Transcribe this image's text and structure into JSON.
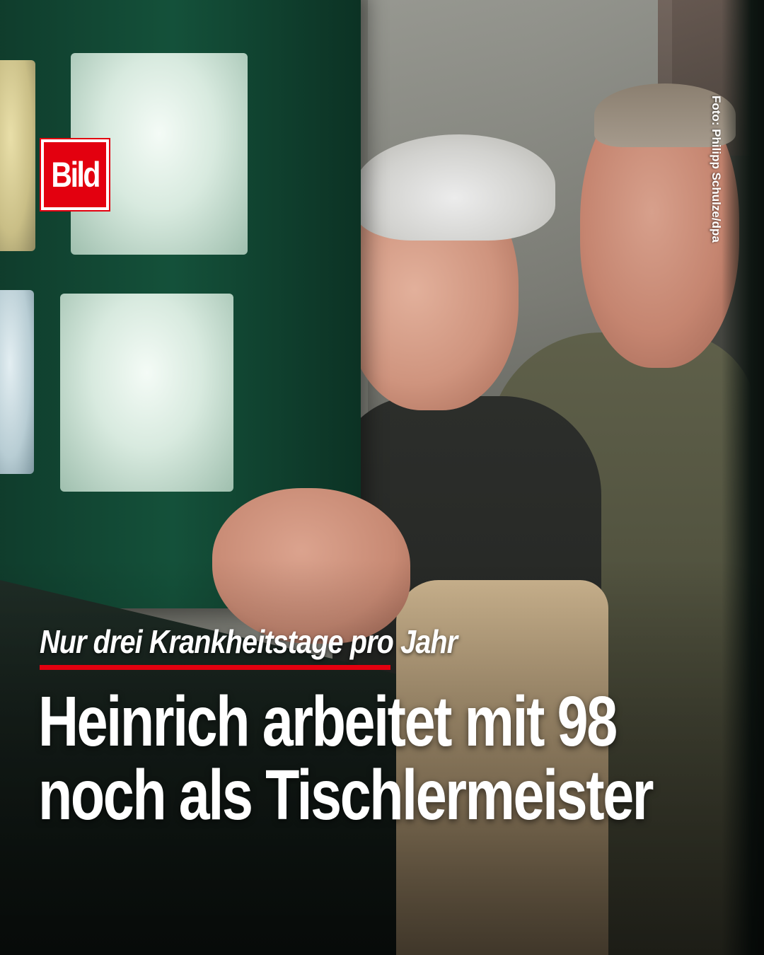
{
  "logo": {
    "text": "Bild",
    "color": "#e3000f"
  },
  "photo": {
    "credit": "Foto: Philipp Schulze/dpa"
  },
  "kicker": {
    "text": "Nur drei Krankheitstage pro Jahr",
    "underline_color": "#e3000f"
  },
  "headline": {
    "line1": "Heinrich arbeitet mit 98",
    "line2": "noch als Tischlermeister"
  }
}
